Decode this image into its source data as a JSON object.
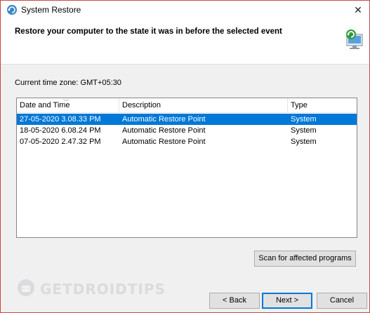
{
  "window": {
    "title": "System Restore",
    "close_glyph": "✕"
  },
  "header": {
    "heading": "Restore your computer to the state it was in before the selected event",
    "icon": "system-restore-icon"
  },
  "timezone_label": "Current time zone: GMT+05:30",
  "restore_list": {
    "columns": [
      "Date and Time",
      "Description",
      "Type"
    ],
    "sorted_column": "Date and Time",
    "rows": [
      {
        "date": "27-05-2020 3.08.33 PM",
        "description": "Automatic Restore Point",
        "type": "System",
        "selected": true
      },
      {
        "date": "18-05-2020 6.08.24 PM",
        "description": "Automatic Restore Point",
        "type": "System",
        "selected": false
      },
      {
        "date": "07-05-2020 2.47.32 PM",
        "description": "Automatic Restore Point",
        "type": "System",
        "selected": false
      }
    ]
  },
  "buttons": {
    "scan": "Scan for affected programs",
    "back": "< Back",
    "next": "Next >",
    "cancel": "Cancel"
  },
  "watermark": "GETDROIDTIPS",
  "colors": {
    "selection": "#0078d7",
    "default_button_border": "#0078d7"
  }
}
